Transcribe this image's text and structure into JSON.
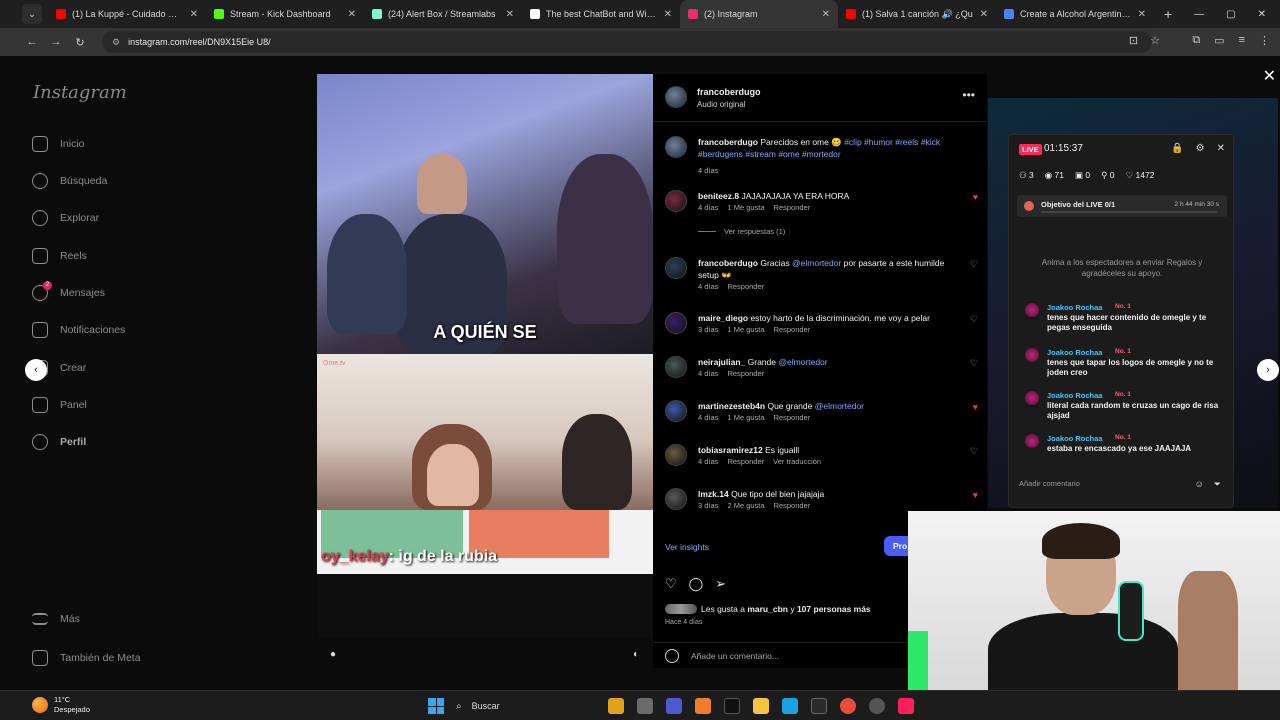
{
  "browser": {
    "tabs": [
      {
        "label": "(1) La Kuppé - Cuidado Que Te",
        "color": "#ff0000",
        "active": false
      },
      {
        "label": "Stream - Kick Dashboard",
        "color": "#53fc18",
        "active": false
      },
      {
        "label": "(24) Alert Box / Streamlabs",
        "color": "#80f5d2",
        "active": false
      },
      {
        "label": "The best ChatBot and Widgets",
        "color": "#ffffff",
        "active": false
      },
      {
        "label": "(2) Instagram",
        "color": "#e1306c",
        "active": true
      },
      {
        "label": "(1) Salva 1 canción 🔊 ¿Qu",
        "color": "#ff0000",
        "active": false
      },
      {
        "label": "Create a Alcohol Argentina (Es",
        "color": "#4285f4",
        "active": false
      }
    ],
    "url": "instagram.com/reel/DN9X15Eie U8/"
  },
  "sidebar": {
    "logo": "Instagram",
    "items": [
      {
        "label": "Inicio",
        "icon": "home-icon"
      },
      {
        "label": "Búsqueda",
        "icon": "search-icon"
      },
      {
        "label": "Explorar",
        "icon": "compass-icon"
      },
      {
        "label": "Reels",
        "icon": "reels-icon"
      },
      {
        "label": "Mensajes",
        "icon": "messenger-icon",
        "badge": "2"
      },
      {
        "label": "Notificaciones",
        "icon": "heart-icon"
      },
      {
        "label": "Crear",
        "icon": "plus-icon"
      },
      {
        "label": "Panel",
        "icon": "chart-icon"
      },
      {
        "label": "Perfil",
        "icon": "avatar-icon"
      }
    ],
    "more": "Más",
    "meta": "También de Meta"
  },
  "video": {
    "caption": "A QUIÉN SE",
    "watermark": "Ome.tv",
    "chat_user": "oy_kelay",
    "chat_text": ": ig de la rubia"
  },
  "post": {
    "username": "francoberdugo",
    "audio": "Audio original",
    "caption": {
      "user": "francoberdugo",
      "text": "Parecidos en ome 🥴",
      "tags": "#clip #humor #reels #kick #berdugens #stream #ome #mortedor",
      "time": "4 días"
    },
    "comments": [
      {
        "user": "beniteez.8",
        "text": "JAJAJAJAJA YA ERA HORA",
        "time": "4 días",
        "likes": "1 Me gusta",
        "reply": "Responder",
        "liked": true,
        "view_replies": "Ver respuestas (1)"
      },
      {
        "user": "francoberdugo",
        "text": "Gracias",
        "mention": "@elmortedor",
        "text2": "por pasarte a este humilde setup 👐",
        "time": "4 días",
        "likes": "",
        "reply": "Responder",
        "liked": false
      },
      {
        "user": "maire_diego",
        "text": "estoy harto de la discriminación. me voy a pelar",
        "time": "3 días",
        "likes": "1 Me gusta",
        "reply": "Responder",
        "liked": false
      },
      {
        "user": "neirajulian_",
        "text": "Grande",
        "mention": "@elmortedor",
        "time": "4 días",
        "likes": "",
        "reply": "Responder",
        "liked": false
      },
      {
        "user": "martinezesteb4n",
        "text": "Que grande",
        "mention": "@elmortedor",
        "time": "4 días",
        "likes": "1 Me gusta",
        "reply": "Responder",
        "liked": true
      },
      {
        "user": "tobiasramirez12",
        "text": "Es igualll",
        "time": "4 días",
        "likes": "",
        "reply": "Responder",
        "translate": "Ver traducción",
        "liked": false
      },
      {
        "user": "lmzk.14",
        "text": "Que tipo del bien jajajaja",
        "time": "3 días",
        "likes": "2 Me gusta",
        "reply": "Responder",
        "liked": true
      }
    ],
    "insights": "Ver insights",
    "promote": "Pro",
    "likes_prefix": "Les gusta a",
    "likes_user": "maru_cbn",
    "likes_mid": "y",
    "likes_count": "107 personas más",
    "ago": "Hace 4 días",
    "add_comment": "Añade un comentario..."
  },
  "live": {
    "badge": "LIVE",
    "time": "01:15:37",
    "stats": {
      "users": "3",
      "viewers": "71",
      "gifts": "0",
      "follows": "0",
      "likes": "1472"
    },
    "goal_label": "Objetivo del LIVE 0/1",
    "goal_time": "2 h 44 min 30 s",
    "hint": "Anima a los espectadores a enviar Regalos y agradéceles su apoyo.",
    "messages": [
      {
        "user": "Joakoo Rochaa",
        "badge": "No. 1",
        "text": "tenes que hacer contenido de omegle y te pegas enseguida"
      },
      {
        "user": "Joakoo Rochaa",
        "badge": "No. 1",
        "text": "tenes que tapar los logos de omegle y no te joden creo"
      },
      {
        "user": "Joakoo Rochaa",
        "badge": "No. 1",
        "text": "literal cada random te cruzas un cago de risa ajsjad"
      },
      {
        "user": "Joakoo Rochaa",
        "badge": "No. 1",
        "text": "estaba re encascado ya ese JAAJAJA"
      }
    ],
    "input_placeholder": "Añadir comentario"
  },
  "taskbar": {
    "temp": "11°C",
    "weather": "Despejado",
    "search": "Buscar"
  }
}
